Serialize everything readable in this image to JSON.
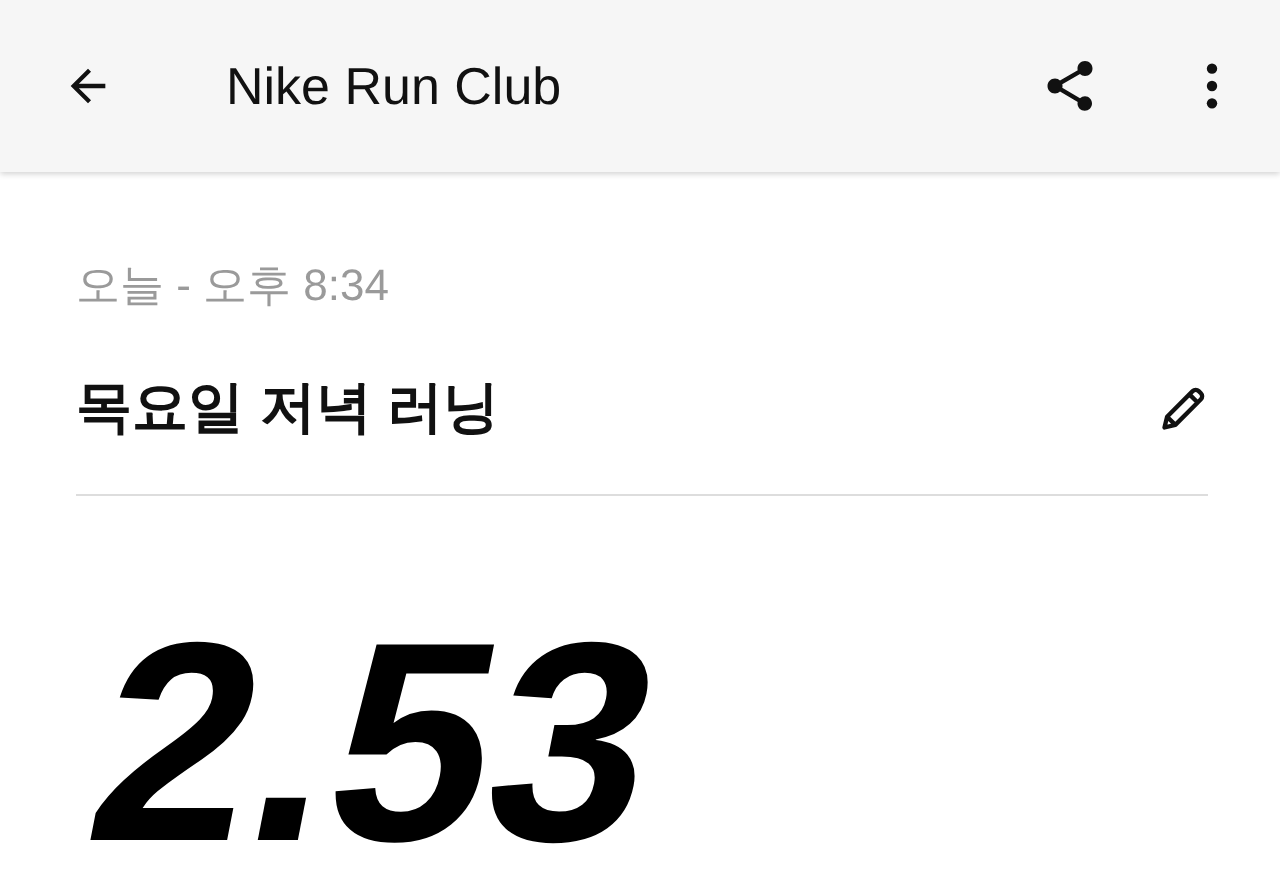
{
  "app_bar": {
    "title": "Nike Run Club"
  },
  "activity": {
    "timestamp": "오늘 - 오후 8:34",
    "name": "목요일 저녁 러닝",
    "distance": "2.53"
  }
}
